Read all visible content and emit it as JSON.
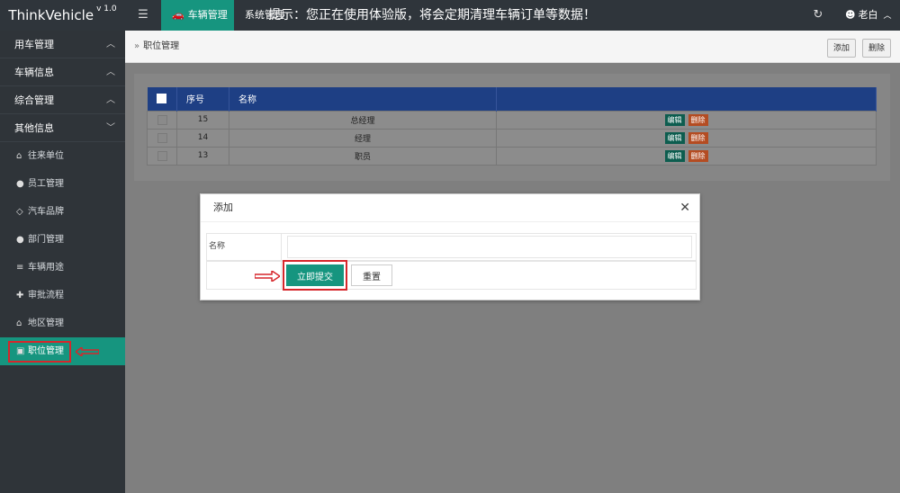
{
  "header": {
    "brand": "ThinkVehicle",
    "version": "v 1.0",
    "menu_icon": "menu-icon",
    "active_tab": "车辆管理",
    "system_tab": "系统管理",
    "notice": "提示：您正在使用体验版，将会定期清理车辆订单等数据！",
    "refresh_icon": "refresh-icon",
    "user_name": "老白"
  },
  "sidebar": {
    "groups": [
      {
        "label": "用车管理",
        "chevron": "chevron-up"
      },
      {
        "label": "车辆信息",
        "chevron": "chevron-up"
      },
      {
        "label": "综合管理",
        "chevron": "chevron-up"
      },
      {
        "label": "其他信息",
        "chevron": "chevron-down"
      }
    ],
    "items": [
      {
        "label": "往来单位",
        "icon": "bank-icon"
      },
      {
        "label": "员工管理",
        "icon": "user-icon"
      },
      {
        "label": "汽车品牌",
        "icon": "diamond-icon"
      },
      {
        "label": "部门管理",
        "icon": "users-icon"
      },
      {
        "label": "车辆用途",
        "icon": "list-icon"
      },
      {
        "label": "审批流程",
        "icon": "puzzle-icon"
      },
      {
        "label": "地区管理",
        "icon": "home-icon"
      },
      {
        "label": "职位管理",
        "icon": "camera-icon"
      }
    ],
    "active_item": "职位管理"
  },
  "breadcrumb": {
    "current": "职位管理"
  },
  "toolbar": {
    "add_label": "添加",
    "delete_label": "删除"
  },
  "table": {
    "columns": [
      "序号",
      "名称",
      ""
    ],
    "rows": [
      {
        "id": "15",
        "name": "总经理"
      },
      {
        "id": "14",
        "name": "经理"
      },
      {
        "id": "13",
        "name": "职员"
      }
    ],
    "edit_label": "编辑",
    "delete_label": "删除"
  },
  "modal": {
    "title": "添加",
    "close_icon": "close-icon",
    "field_label": "名称",
    "field_value": "",
    "submit_label": "立即提交",
    "reset_label": "重置"
  },
  "colors": {
    "accent": "#16957f",
    "header_bg": "#2f353b",
    "table_header": "#1e3f84",
    "highlight": "#d6262b"
  }
}
